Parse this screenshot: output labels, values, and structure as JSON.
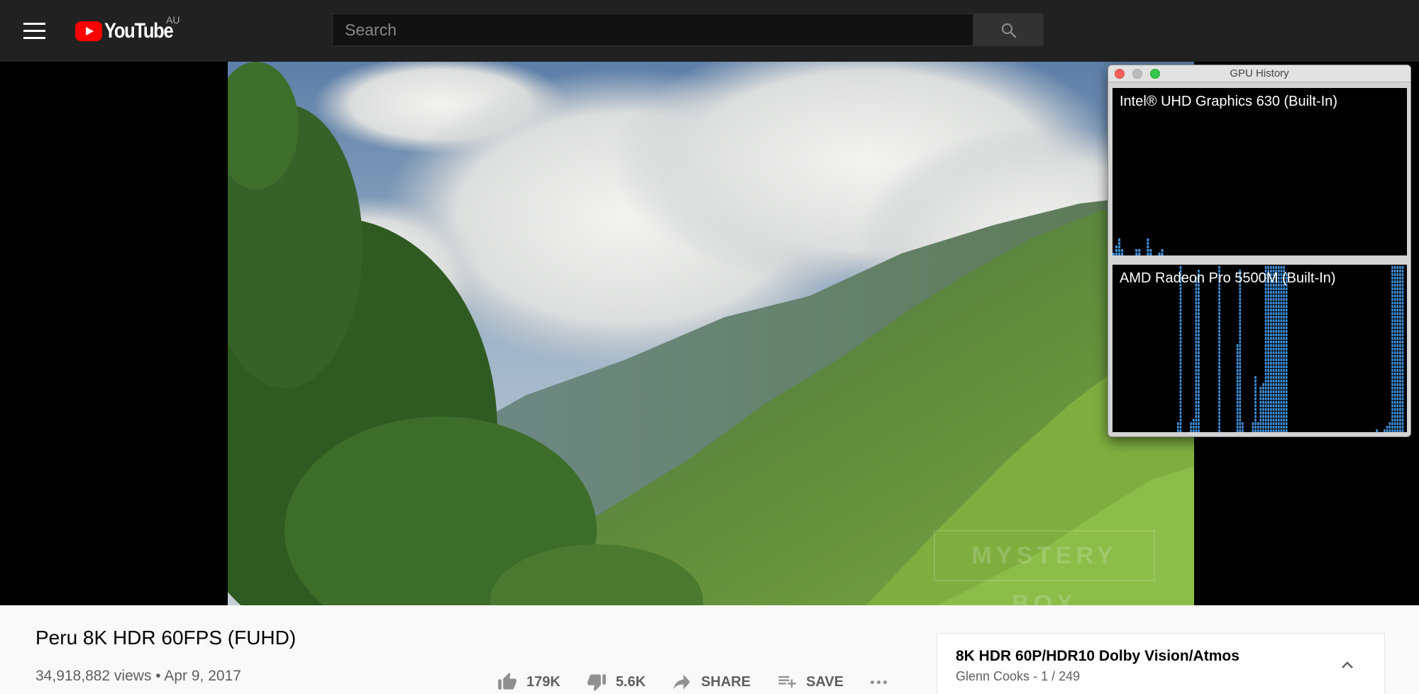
{
  "masthead": {
    "menu_icon": "hamburger-menu-icon",
    "logo_text": "YouTube",
    "country_code": "AU",
    "search_placeholder": "Search",
    "search_icon": "search-icon"
  },
  "video": {
    "watermark_text": "MYSTERY BOX",
    "title": "Peru 8K HDR 60FPS (FUHD)",
    "views": "34,918,882 views",
    "separator": "•",
    "date": "Apr 9, 2017"
  },
  "actions": {
    "likes": "179K",
    "dislikes": "5.6K",
    "share_label": "SHARE",
    "save_label": "SAVE",
    "icons": [
      "thumb-up-icon",
      "thumb-down-icon",
      "share-icon",
      "playlist-add-icon",
      "more-icon"
    ]
  },
  "playlist": {
    "title": "8K HDR 60P/HDR10 Dolby Vision/Atmos",
    "owner": "Glenn Cooks",
    "separator": "-",
    "position": "1 / 249"
  },
  "gpu_window": {
    "title": "GPU History",
    "bar_color": "#3f8fd8",
    "gpus": [
      {
        "name": "Intel® UHD Graphics 630 (Built-In)",
        "utilization": [
          0.02,
          0.06,
          0.1,
          0.04,
          0,
          0,
          0,
          0,
          0.03,
          0.04,
          0,
          0,
          0.1,
          0.04,
          0,
          0,
          0.02,
          0.03,
          0,
          0,
          0,
          0,
          0,
          0,
          0,
          0,
          0,
          0,
          0,
          0,
          0,
          0,
          0,
          0,
          0,
          0,
          0,
          0,
          0,
          0,
          0,
          0,
          0,
          0,
          0,
          0,
          0,
          0,
          0,
          0,
          0,
          0,
          0,
          0,
          0,
          0,
          0,
          0,
          0,
          0,
          0,
          0,
          0,
          0,
          0,
          0,
          0,
          0,
          0,
          0,
          0,
          0,
          0,
          0,
          0,
          0,
          0,
          0,
          0,
          0,
          0,
          0,
          0,
          0,
          0,
          0,
          0,
          0,
          0,
          0,
          0,
          0,
          0,
          0,
          0,
          0,
          0,
          0,
          0,
          0,
          0,
          0,
          0
        ]
      },
      {
        "name": "AMD Radeon Pro 5500M (Built-In)",
        "utilization": [
          0,
          0,
          0,
          0,
          0,
          0,
          0,
          0,
          0,
          0,
          0,
          0,
          0,
          0,
          0,
          0,
          0,
          0,
          0,
          0,
          0,
          0,
          0,
          0,
          0,
          0.06,
          1,
          0,
          0,
          0,
          0.06,
          0.07,
          0.94,
          0.98,
          0,
          0,
          0,
          0,
          0,
          0,
          0,
          1,
          0,
          0,
          0,
          0,
          0,
          0,
          0.52,
          0.98,
          0.05,
          0,
          0,
          0,
          0.05,
          0.33,
          0.05,
          0.28,
          0.3,
          1,
          1,
          1,
          1,
          1,
          1,
          1,
          1,
          0.96,
          0,
          0,
          0,
          0,
          0,
          0,
          0,
          0,
          0,
          0,
          0,
          0,
          0,
          0,
          0,
          0,
          0,
          0,
          0,
          0,
          0,
          0,
          0,
          0,
          0,
          0,
          0,
          0,
          0,
          0,
          0,
          0,
          0,
          0,
          0.02,
          0,
          0,
          0.02,
          0.03,
          0.06,
          1,
          1,
          1,
          1,
          1,
          0
        ]
      }
    ]
  }
}
